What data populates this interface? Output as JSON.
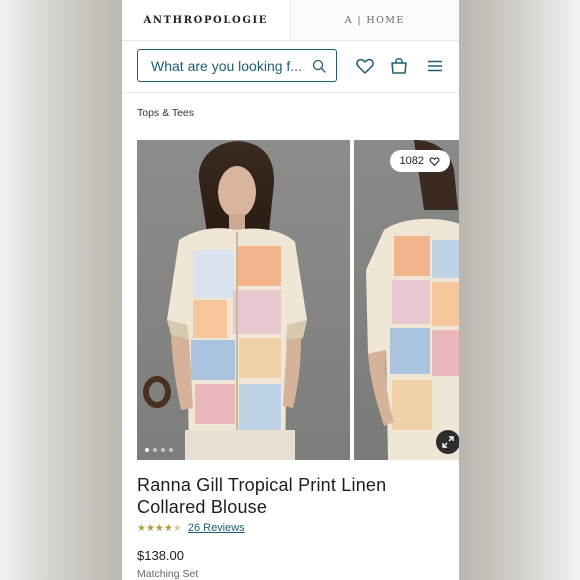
{
  "brand_tabs": {
    "brand": "ANTHROPOLOGIE",
    "home": "A | HOME"
  },
  "header": {
    "search_placeholder": "What are you looking f...",
    "icons": [
      "search-icon",
      "heart-icon",
      "bag-icon",
      "menu-icon"
    ]
  },
  "breadcrumb": "Tops & Tees",
  "gallery": {
    "likes": "1082",
    "image_count_dots": 4,
    "active_dot": 1
  },
  "product": {
    "title": "Ranna Gill Tropical Print Linen Collared Blouse",
    "rating": 4.5,
    "reviews": "26 Reviews",
    "price": "$138.00",
    "matching_set": "Matching Set"
  },
  "colors": {
    "accent": "#1f5d73",
    "stars": "#b99b3c"
  }
}
